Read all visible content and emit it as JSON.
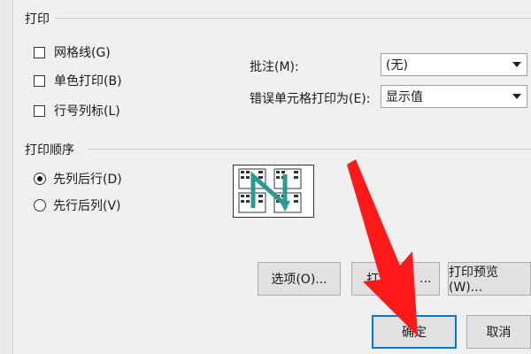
{
  "print_section": {
    "title": "打印",
    "checkboxes": [
      {
        "label": "网格线(G)",
        "checked": false
      },
      {
        "label": "单色打印(B)",
        "checked": false
      },
      {
        "label": "行号列标(L)",
        "checked": false
      }
    ],
    "comments_label": "批注(M):",
    "comments_value": "(无)",
    "errors_label": "错误单元格打印为(E):",
    "errors_value": "显示值"
  },
  "order_section": {
    "title": "打印顺序",
    "options": [
      {
        "label": "先列后行(D)",
        "selected": true
      },
      {
        "label": "先行后列(V)",
        "selected": false
      }
    ]
  },
  "buttons": {
    "options": "选项(O)...",
    "print": "打",
    "print_suffix": "...",
    "preview": "打印预览(W)...",
    "ok": "确定",
    "cancel": "取消"
  },
  "colors": {
    "accent": "#0078d7",
    "annotation_arrow": "#ff1a1a",
    "diagram_arrow": "#2a9a92"
  }
}
